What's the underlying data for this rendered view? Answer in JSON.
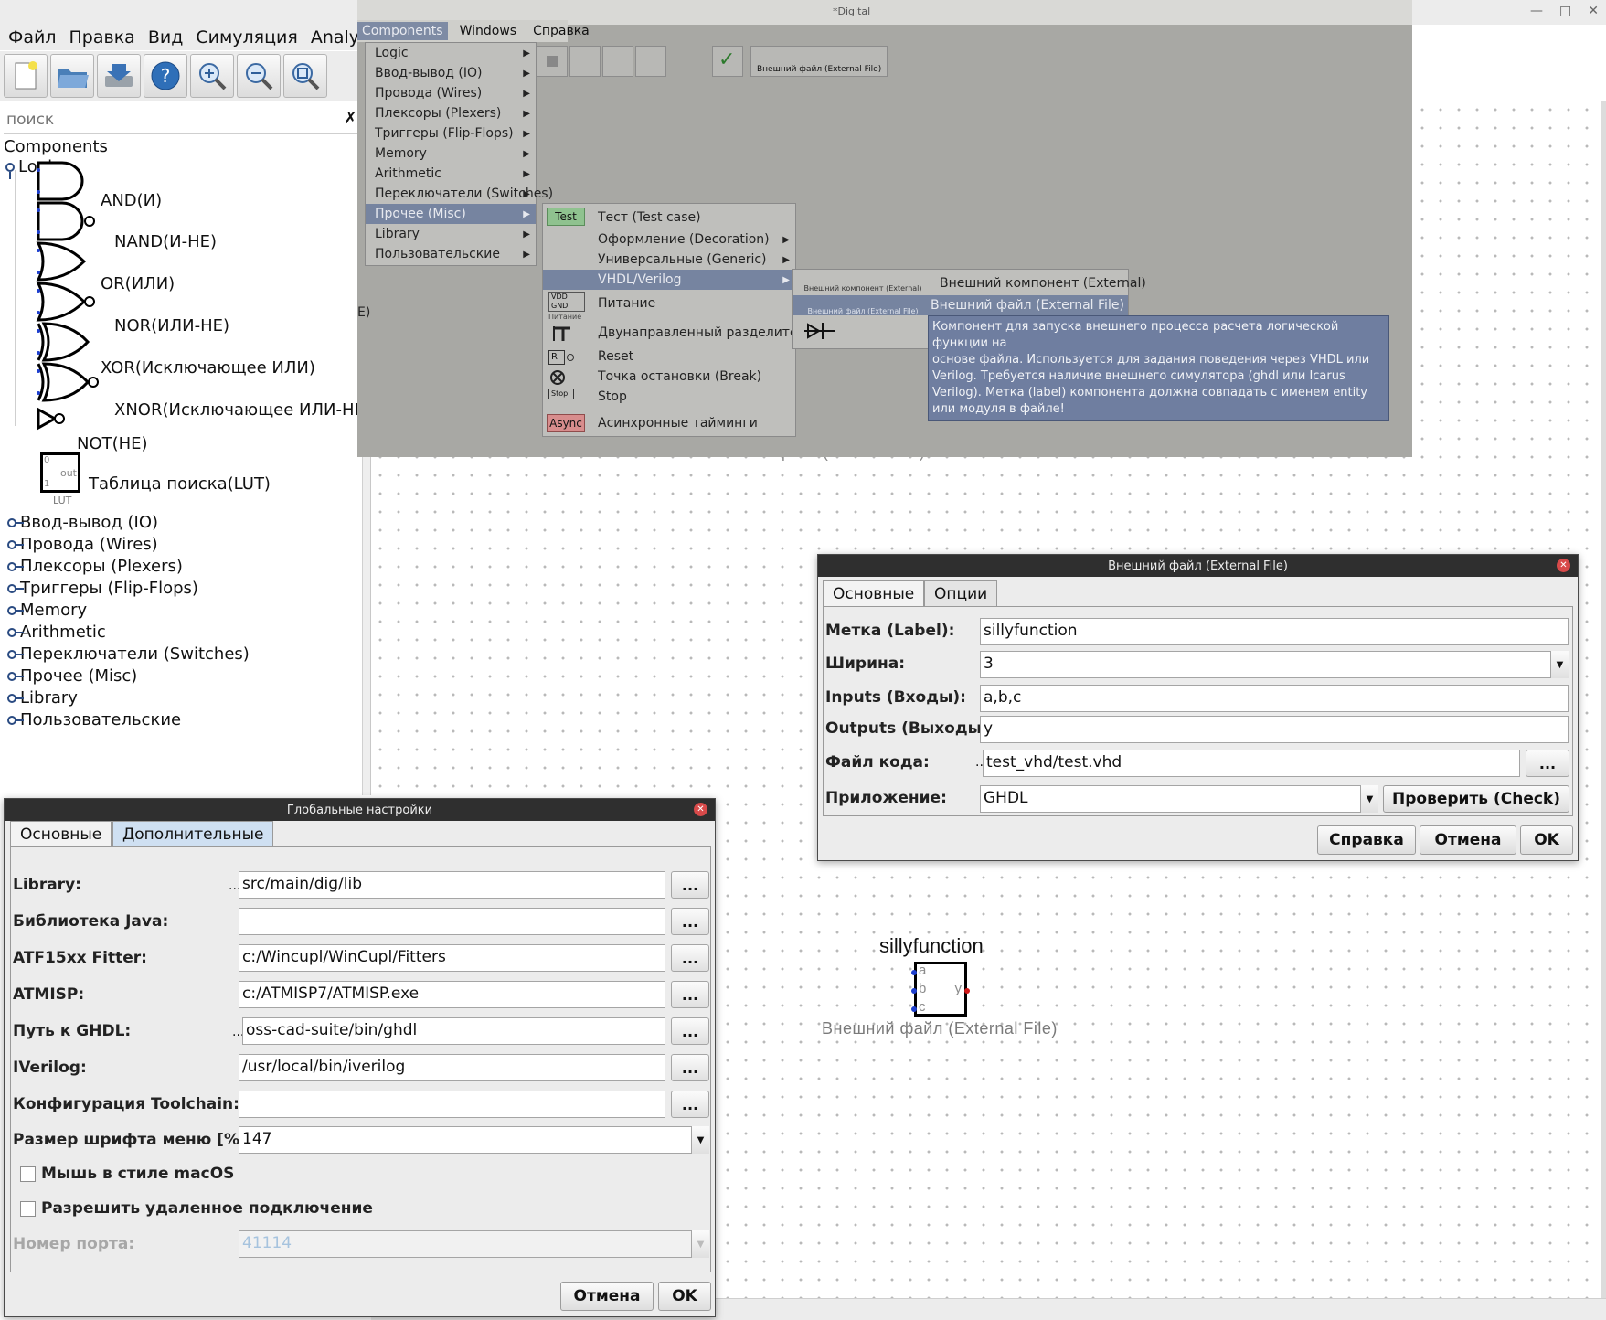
{
  "window": {
    "menu": [
      "Файл",
      "Правка",
      "Вид",
      "Симуляция",
      "Analysis"
    ],
    "toolbar_icons": [
      "new-file-icon",
      "open-folder-icon",
      "save-icon",
      "help-icon",
      "zoom-in-icon",
      "zoom-out-icon",
      "zoom-fit-icon"
    ],
    "search_placeholder": "поиск",
    "search_clear": "✗"
  },
  "tree": {
    "root": "Components",
    "logic_group": "Logic",
    "gates": [
      "AND(И)",
      "NAND(И-НЕ)",
      "OR(ИЛИ)",
      "NOR(ИЛИ-НЕ)",
      "XOR(Исключающее ИЛИ)",
      "XNOR(Исключающее ИЛИ-НЕ)",
      "NOT(НЕ)",
      "Таблица поиска(LUT)"
    ],
    "lut_pins": {
      "in0": "0",
      "in1": "1",
      "out": "out",
      "caption": "LUT"
    },
    "groups": [
      "Ввод-вывод (IO)",
      "Провода (Wires)",
      "Плексоры (Plexers)",
      "Триггеры (Flip-Flops)",
      "Memory",
      "Arithmetic",
      "Переключатели (Switches)",
      "Прочее (Misc)",
      "Library",
      "Пользовательские"
    ]
  },
  "photo": {
    "title": "*Digital",
    "menubar": [
      "Components",
      "Windows",
      "Справка"
    ],
    "components_menu": [
      "Logic",
      "Ввод-вывод (IO)",
      "Провода (Wires)",
      "Плексоры (Plexers)",
      "Триггеры (Flip-Flops)",
      "Memory",
      "Arithmetic",
      "Переключатели (Switches)",
      "Прочее (Misc)",
      "Library",
      "Пользовательские"
    ],
    "misc_menu": [
      "Тест (Test case)",
      "Оформление (Decoration)",
      "Универсальные (Generic)",
      "VHDL/Verilog",
      "Питание",
      "Двунаправленный разделитель",
      "Reset",
      "Точка остановки (Break)",
      "Stop",
      "Асинхронные тайминги"
    ],
    "misc_icon_labels": {
      "test": "Test",
      "async": "Async",
      "vdd": "VDD",
      "gnd": "GND",
      "supply": "Питание",
      "reset": "R",
      "stop": "Stop"
    },
    "vhdl_menu": [
      "Внешний компонент (External)",
      "Внешний файл (External File)"
    ],
    "vhdl_icon_labels": [
      "Внешний компонент (External)",
      "Внешний файл (External File)"
    ],
    "toolbar_chip": "Внешний файл (External File)",
    "tooltip": [
      "Компонент для запуска внешнего процесса расчета логической функции на",
      "основе файла. Используется для задания поведения через VHDL или",
      "Verilog. Требуется наличие внешнего симулятора (ghdl или Icarus",
      "Verilog). Метка (label) компонента должна совпадать с именем entity",
      "или модуля в файле!"
    ],
    "left_fragment": "E)"
  },
  "ext_dialog": {
    "title": "Внешний файл (External File)",
    "tabs": [
      "Основные",
      "Опции"
    ],
    "fields": [
      {
        "label": "Метка (Label):",
        "value": "sillyfunction"
      },
      {
        "label": "Ширина:",
        "value": "3"
      },
      {
        "label": "Inputs (Входы):",
        "value": "a,b,c"
      },
      {
        "label": "Outputs (Выходы):",
        "value": "y"
      },
      {
        "label": "Файл кода:",
        "value": "test_vhd/test.vhd"
      },
      {
        "label": "Приложение:",
        "value": "GHDL"
      }
    ],
    "ellipsis": "...",
    "check_button": "Проверить (Check)",
    "buttons": [
      "Справка",
      "Отмена",
      "OK"
    ]
  },
  "global_dialog": {
    "title": "Глобальные настройки",
    "tabs": [
      "Основные",
      "Дополнительные"
    ],
    "rows": [
      {
        "label": "Library:",
        "value": "src/main/dig/lib"
      },
      {
        "label": "Библиотека Java:",
        "value": ""
      },
      {
        "label": "ATF15xx Fitter:",
        "value": "c:/Wincupl/WinCupl/Fitters"
      },
      {
        "label": "ATMISP:",
        "value": "c:/ATMISP7/ATMISP.exe"
      },
      {
        "label": "Путь к GHDL:",
        "value": "oss-cad-suite/bin/ghdl"
      },
      {
        "label": "IVerilog:",
        "value": "/usr/local/bin/iverilog"
      },
      {
        "label": "Конфигурация Toolchain:",
        "value": ""
      }
    ],
    "font_size_label": "Размер шрифта меню [%]:",
    "font_size_value": "147",
    "checkboxes": [
      "Мышь в стиле macOS",
      "Разрешить удаленное подключение"
    ],
    "port_label": "Номер порта:",
    "port_value": "41114",
    "ellipsis": "...",
    "buttons": [
      "Отмена",
      "OK"
    ]
  },
  "canvas": {
    "component_label": "sillyfunction",
    "inputs": [
      "a",
      "b",
      "c"
    ],
    "output": "y",
    "caption": "Внешний файл (External File)",
    "ghost_caption": "Внешний файл (External File)"
  },
  "colors": {
    "pin_input": "#1d3fcf",
    "pin_output": "#d01818",
    "tooltip": "#6f7ea0",
    "menu_selected": "#7684a0"
  }
}
